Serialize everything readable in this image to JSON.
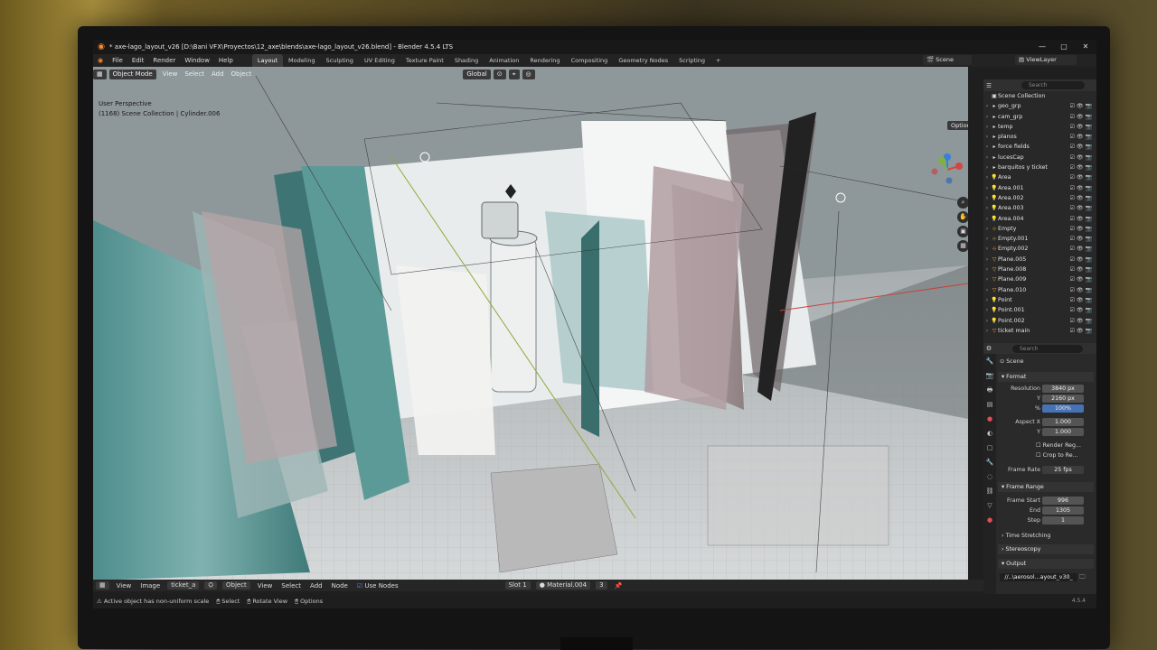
{
  "window": {
    "title": "* axe-lago_layout_v26 [D:\\Bani VFX\\Proyectos\\12_axe\\blends\\axe-lago_layout_v26.blend] - Blender 4.5.4 LTS",
    "minimize": "—",
    "maximize": "▢",
    "close": "✕"
  },
  "menu": {
    "items": [
      "File",
      "Edit",
      "Render",
      "Window",
      "Help"
    ],
    "workspaces": [
      "Layout",
      "Modeling",
      "Sculpting",
      "UV Editing",
      "Texture Paint",
      "Shading",
      "Animation",
      "Rendering",
      "Compositing",
      "Geometry Nodes",
      "Scripting"
    ],
    "active_workspace": "Layout",
    "add_tab": "+",
    "scene": "Scene",
    "view_layer": "ViewLayer"
  },
  "viewport": {
    "mode": "Object Mode",
    "menus": [
      "View",
      "Select",
      "Add",
      "Object"
    ],
    "transform_orientation": "Global",
    "options": "Options",
    "perspective": "User Perspective",
    "collection_info": "(1168) Scene Collection | Cylinder.006"
  },
  "outliner": {
    "search_placeholder": "Search",
    "root": "Scene Collection",
    "items": [
      {
        "name": "geo_grp",
        "icon": "collection-icon"
      },
      {
        "name": "cam_grp",
        "icon": "collection-icon"
      },
      {
        "name": "temp",
        "icon": "collection-icon"
      },
      {
        "name": "planos",
        "icon": "collection-icon"
      },
      {
        "name": "force fields",
        "icon": "collection-icon"
      },
      {
        "name": "lucesCap",
        "icon": "collection-icon"
      },
      {
        "name": "barquitos y ticket",
        "icon": "collection-icon"
      },
      {
        "name": "Area",
        "icon": "light-icon"
      },
      {
        "name": "Area.001",
        "icon": "light-icon"
      },
      {
        "name": "Area.002",
        "icon": "light-icon"
      },
      {
        "name": "Area.003",
        "icon": "light-icon"
      },
      {
        "name": "Area.004",
        "icon": "light-icon"
      },
      {
        "name": "Empty",
        "icon": "empty-icon"
      },
      {
        "name": "Empty.001",
        "icon": "empty-icon"
      },
      {
        "name": "Empty.002",
        "icon": "empty-icon"
      },
      {
        "name": "Plane.005",
        "icon": "mesh-icon"
      },
      {
        "name": "Plane.008",
        "icon": "mesh-icon"
      },
      {
        "name": "Plane.009",
        "icon": "mesh-icon"
      },
      {
        "name": "Plane.010",
        "icon": "mesh-icon"
      },
      {
        "name": "Point",
        "icon": "light-icon"
      },
      {
        "name": "Point.001",
        "icon": "light-icon"
      },
      {
        "name": "Point.002",
        "icon": "light-icon"
      },
      {
        "name": "ticket main",
        "icon": "mesh-icon"
      }
    ]
  },
  "properties": {
    "search_placeholder": "Search",
    "context": "Scene",
    "format_header": "Format",
    "resolution_label": "Resolution",
    "res_x": "3840 px",
    "y_label": "Y",
    "res_y": "2160 px",
    "pct_label": "%",
    "res_pct": "100%",
    "aspect_label": "Aspect X",
    "aspect_x": "1.000",
    "aspect_y": "1.000",
    "render_region": "Render Reg...",
    "crop": "Crop to Re...",
    "frame_rate_label": "Frame Rate",
    "frame_rate": "25 fps",
    "frame_range_header": "Frame Range",
    "frame_start_label": "Frame Start",
    "frame_start": "996",
    "end_label": "End",
    "frame_end": "1305",
    "step_label": "Step",
    "step": "1",
    "time_stretching": "Time Stretching",
    "stereoscopy": "Stereoscopy",
    "output_header": "Output",
    "output_path": "//..\\aerosol...ayout_v30_"
  },
  "footer": {
    "menus": [
      "View",
      "Image"
    ],
    "image_name": "ticket_a",
    "object": "Object",
    "menus2": [
      "View",
      "Select",
      "Add",
      "Node"
    ],
    "use_nodes": "Use Nodes",
    "slot": "Slot 1",
    "material": "Material.004",
    "users": "3"
  },
  "status": {
    "warning": "Active object has non-uniform scale",
    "select": "Select",
    "rotate": "Rotate View",
    "options": "Options",
    "version": "4.5.4"
  }
}
